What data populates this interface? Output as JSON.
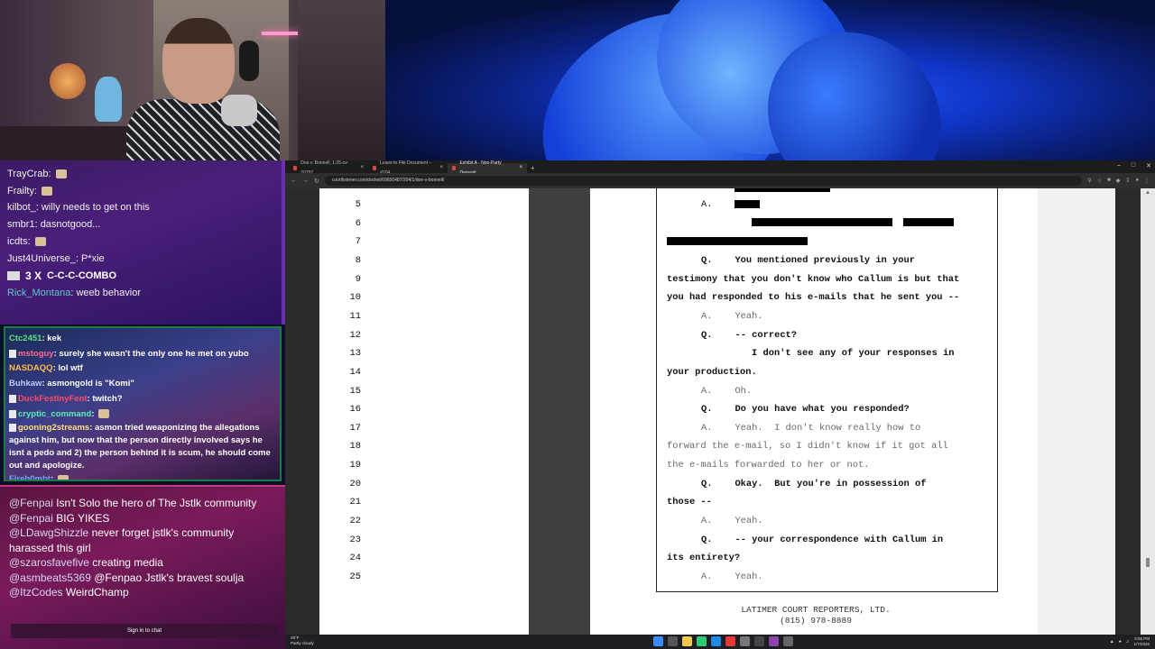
{
  "chat_top": {
    "lines": [
      {
        "user": "TrayCrab",
        "text": ""
      },
      {
        "user": "Frailty",
        "text": ""
      },
      {
        "user": "kilbot_",
        "text": "willy needs to get on this"
      },
      {
        "user": "smbr1",
        "text": "dasnotgood..."
      },
      {
        "user": "icdts",
        "text": ""
      },
      {
        "user": "Just4Universe_",
        "text": "P*xie"
      }
    ],
    "combo_count": "3 X",
    "combo_text": "C-C-C-COMBO",
    "rick_user": "Rick_Montana",
    "rick_text": "weeb behavior"
  },
  "chat_mid": [
    {
      "user": "Ctc2451",
      "color": "#5ee07a",
      "text": "kek"
    },
    {
      "user": "mstoguy",
      "color": "#ff6a8a",
      "text": "surely she wasn't the only one he met on yubo"
    },
    {
      "user": "NASDAQQ",
      "color": "#ffb84a",
      "text": "lol wtf"
    },
    {
      "user": "Buhkaw",
      "color": "#c3c9ff",
      "text": "asmongold is \"Komi\""
    },
    {
      "user": "DuckFestinyFent",
      "color": "#ff4a6a",
      "text": "twitch?"
    },
    {
      "user": "cryptic_command",
      "color": "#5ef0b0",
      "text": ""
    },
    {
      "user": "gooning2streams",
      "color": "#ffe07a",
      "text": "asmon tried weaponizing the allegations against him, but now that the person directly involved says he isnt a pedo and 2) the person behind it is scum, he should come out and apologize."
    },
    {
      "user": "Fireb0mbt",
      "color": "#6aa8ff",
      "text": ""
    }
  ],
  "chat_bottom": {
    "messages": [
      {
        "user": "@Fenpai",
        "text": "Isn't Solo the hero of The Jstlk community"
      },
      {
        "user": "@Fenpai",
        "text": "BIG YIKES"
      },
      {
        "user": "@LDawgShizzle",
        "text": "never forget jstlk's community harassed this girl"
      },
      {
        "user": "@szarosfavefive",
        "text": "creating media"
      },
      {
        "user": "@asmbeats5369",
        "text": "@Fenpao Jstlk's bravest soulja"
      },
      {
        "user": "@ItzCodes",
        "text": "WeirdChamp"
      }
    ],
    "signin": "Sign in to chat"
  },
  "browser": {
    "tabs": [
      {
        "label": "Doe v. Bonnell, 1:25-cv-20757 ..."
      },
      {
        "label": "Leave to File Document – #204 ..."
      },
      {
        "label": "Exhibit A - Non-Party Depositi..."
      }
    ],
    "new_tab": "+",
    "url": "courtlistener.com/docket/69650487/204/1/doe-v-bonnell/"
  },
  "transcript": {
    "lines": [
      {
        "n": "5",
        "type": "A",
        "text": "",
        "redact": [
          28
        ]
      },
      {
        "n": "6",
        "type": "redact",
        "text": "",
        "redact": [
          156,
          56
        ]
      },
      {
        "n": "7",
        "type": "redact0",
        "text": "",
        "redact": [
          156
        ]
      },
      {
        "n": "8",
        "type": "Q",
        "text": "You mentioned previously in your"
      },
      {
        "n": "9",
        "type": "cont",
        "text": "testimony that you don't know who Callum is but that"
      },
      {
        "n": "10",
        "type": "cont",
        "text": "you had responded to his e-mails that he sent you --"
      },
      {
        "n": "11",
        "type": "A",
        "text": "Yeah."
      },
      {
        "n": "12",
        "type": "Q",
        "text": "-- correct?"
      },
      {
        "n": "13",
        "type": "indent",
        "text": "I don't see any of your responses in"
      },
      {
        "n": "14",
        "type": "cont",
        "text": "your production."
      },
      {
        "n": "15",
        "type": "A",
        "text": "Oh."
      },
      {
        "n": "16",
        "type": "Q",
        "text": "Do you have what you responded?"
      },
      {
        "n": "17",
        "type": "A",
        "text": "Yeah.  I don't know really how to"
      },
      {
        "n": "18",
        "type": "lightcont",
        "text": "forward the e-mail, so I didn't know if it got all"
      },
      {
        "n": "19",
        "type": "lightcont",
        "text": "the e-mails forwarded to her or not."
      },
      {
        "n": "20",
        "type": "Q",
        "text": "Okay.  But you're in possession of"
      },
      {
        "n": "21",
        "type": "cont",
        "text": "those --"
      },
      {
        "n": "22",
        "type": "A",
        "text": "Yeah."
      },
      {
        "n": "23",
        "type": "Q",
        "text": "-- your correspondence with Callum in"
      },
      {
        "n": "24",
        "type": "cont",
        "text": "its entirety?"
      },
      {
        "n": "25",
        "type": "A",
        "text": "Yeah."
      }
    ],
    "footer_line1": "LATIMER COURT REPORTERS, LTD.",
    "footer_line2": "(815) 978-8889",
    "q_label": "Q.",
    "a_label": "A."
  },
  "taskbar": {
    "weather_temp": "29°F",
    "weather_desc": "Partly cloudy",
    "time": "6:55 PM",
    "date": "1/7/2026"
  }
}
